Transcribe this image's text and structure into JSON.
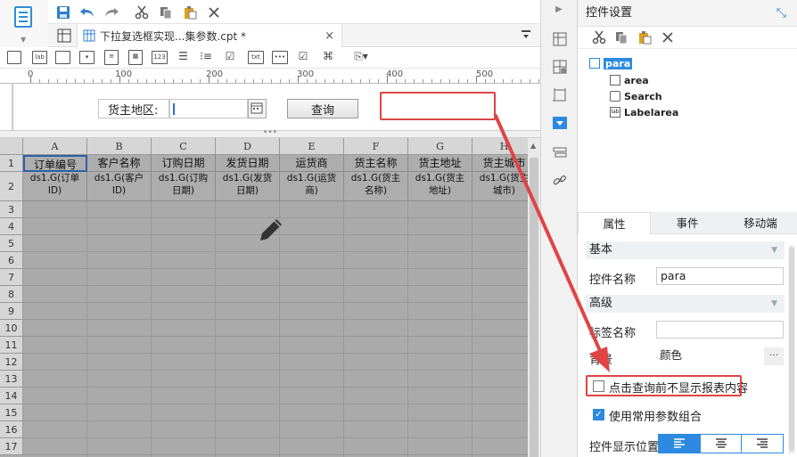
{
  "file_tab": {
    "title": "下拉复选框实现...集参数.cpt *",
    "close": "×"
  },
  "ruler": {
    "marks": [
      "0",
      "100",
      "200",
      "300",
      "400",
      "500"
    ]
  },
  "param_form": {
    "label_text": "货主地区:",
    "input_value": "",
    "query_button": "查询"
  },
  "divider_grip": "•••",
  "grid": {
    "columns": [
      "A",
      "B",
      "C",
      "D",
      "E",
      "F",
      "G",
      "H"
    ],
    "rows": [
      "1",
      "2",
      "3",
      "4",
      "5",
      "6",
      "7",
      "8",
      "9",
      "10",
      "11",
      "12",
      "13",
      "14",
      "15",
      "16",
      "17"
    ],
    "row1": [
      "订单编号",
      "客户名称",
      "订购日期",
      "发货日期",
      "运货商",
      "货主名称",
      "货主地址",
      "货主城市"
    ],
    "row2": [
      [
        "ds1.G(订单",
        "ID)"
      ],
      [
        "ds1.G(客户",
        "ID)"
      ],
      [
        "ds1.G(订购",
        "日期)"
      ],
      [
        "ds1.G(发货",
        "日期)"
      ],
      [
        "ds1.G(运货",
        "商)"
      ],
      [
        "ds1.G(货主",
        "名称)"
      ],
      [
        "ds1.G(货主",
        "地址)"
      ],
      [
        "ds1.G(货主",
        "城市)"
      ]
    ]
  },
  "right_panel": {
    "title": "控件设置",
    "tree": {
      "root": "para",
      "children": [
        "area",
        "Search",
        "Labelarea"
      ]
    },
    "tabs": [
      "属性",
      "事件",
      "移动端"
    ],
    "section_basic": "基本",
    "widget_name_label": "控件名称",
    "widget_name_value": "para",
    "section_advanced": "高级",
    "tag_name_label": "标签名称",
    "tag_name_value": "",
    "background_label": "背景",
    "background_value": "颜色",
    "background_more": "···",
    "check_no_display": "点击查询前不显示报表内容",
    "check_common_param": "使用常用参数组合",
    "display_position_label": "控件显示位置"
  },
  "colors": {
    "accent": "#2d8ae0",
    "highlight_red": "#e04444",
    "grid_bg": "#aaaaaa"
  }
}
